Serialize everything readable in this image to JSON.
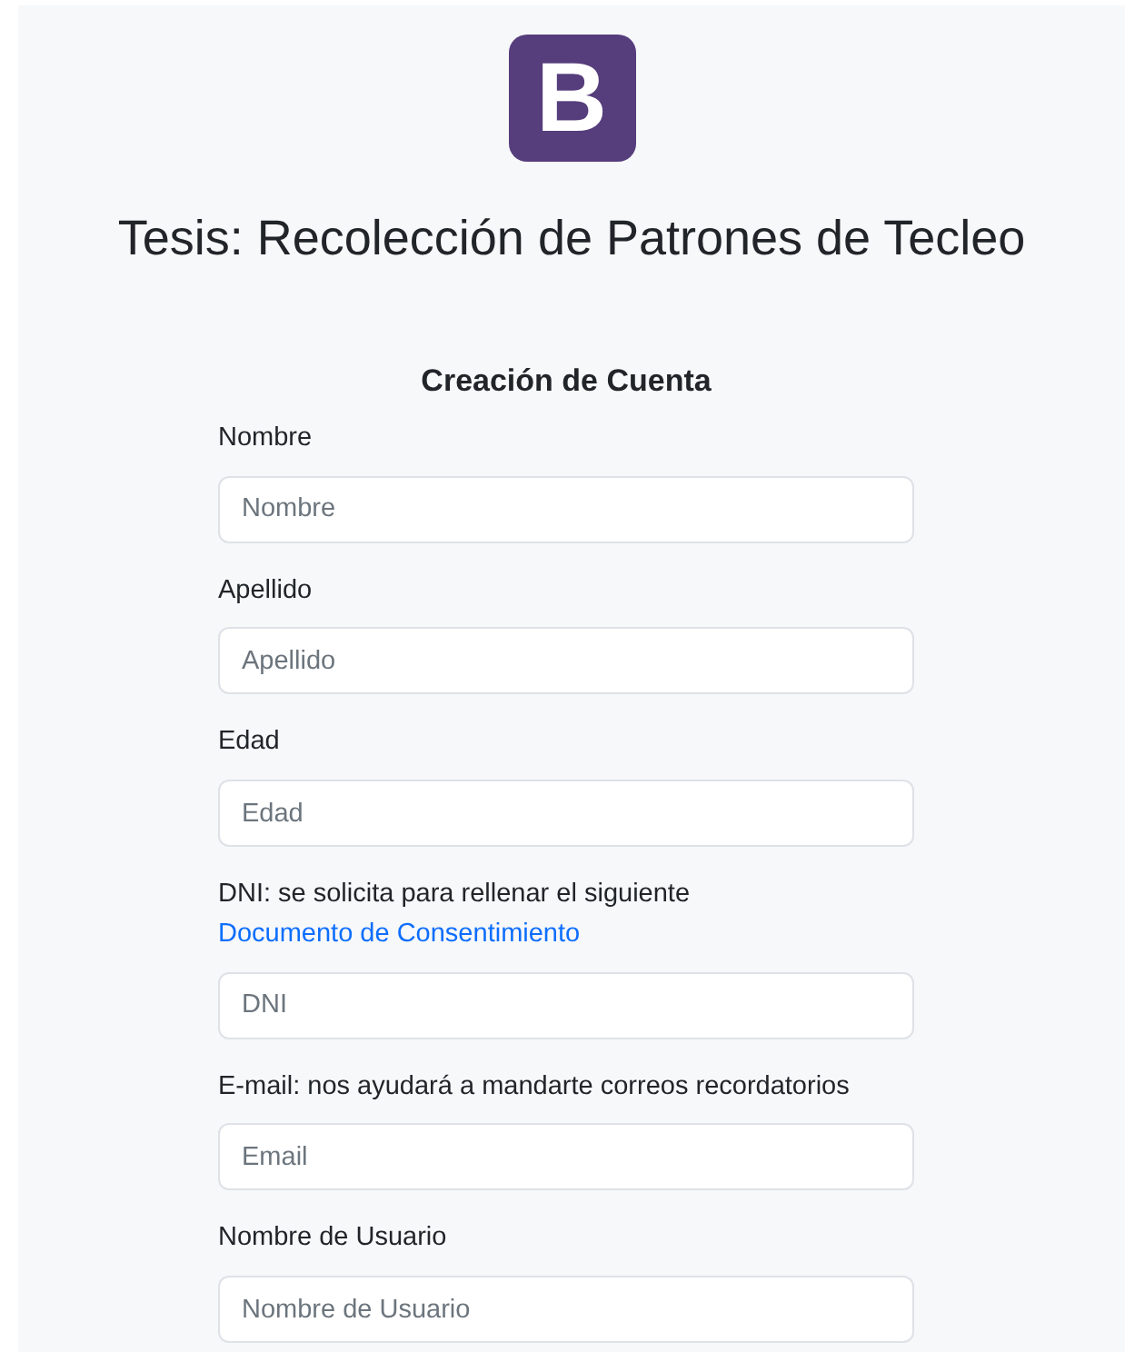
{
  "logo": {
    "letter": "B"
  },
  "title": "Tesis: Recolección de Patrones de Tecleo",
  "form": {
    "heading": "Creación de Cuenta",
    "fields": [
      {
        "kind": "plain",
        "label": "Nombre",
        "placeholder": "Nombre"
      },
      {
        "kind": "plain",
        "label": "Apellido",
        "placeholder": "Apellido"
      },
      {
        "kind": "plain",
        "label": "Edad",
        "placeholder": "Edad"
      },
      {
        "kind": "with_link",
        "label": "DNI: se solicita para rellenar el siguiente",
        "link": "Documento de Consentimiento",
        "placeholder": "DNI"
      },
      {
        "kind": "plain",
        "label": "E-mail: nos ayudará a mandarte correos recordatorios",
        "placeholder": "Email"
      },
      {
        "kind": "plain",
        "label": "Nombre de Usuario",
        "placeholder": "Nombre de Usuario"
      }
    ]
  }
}
